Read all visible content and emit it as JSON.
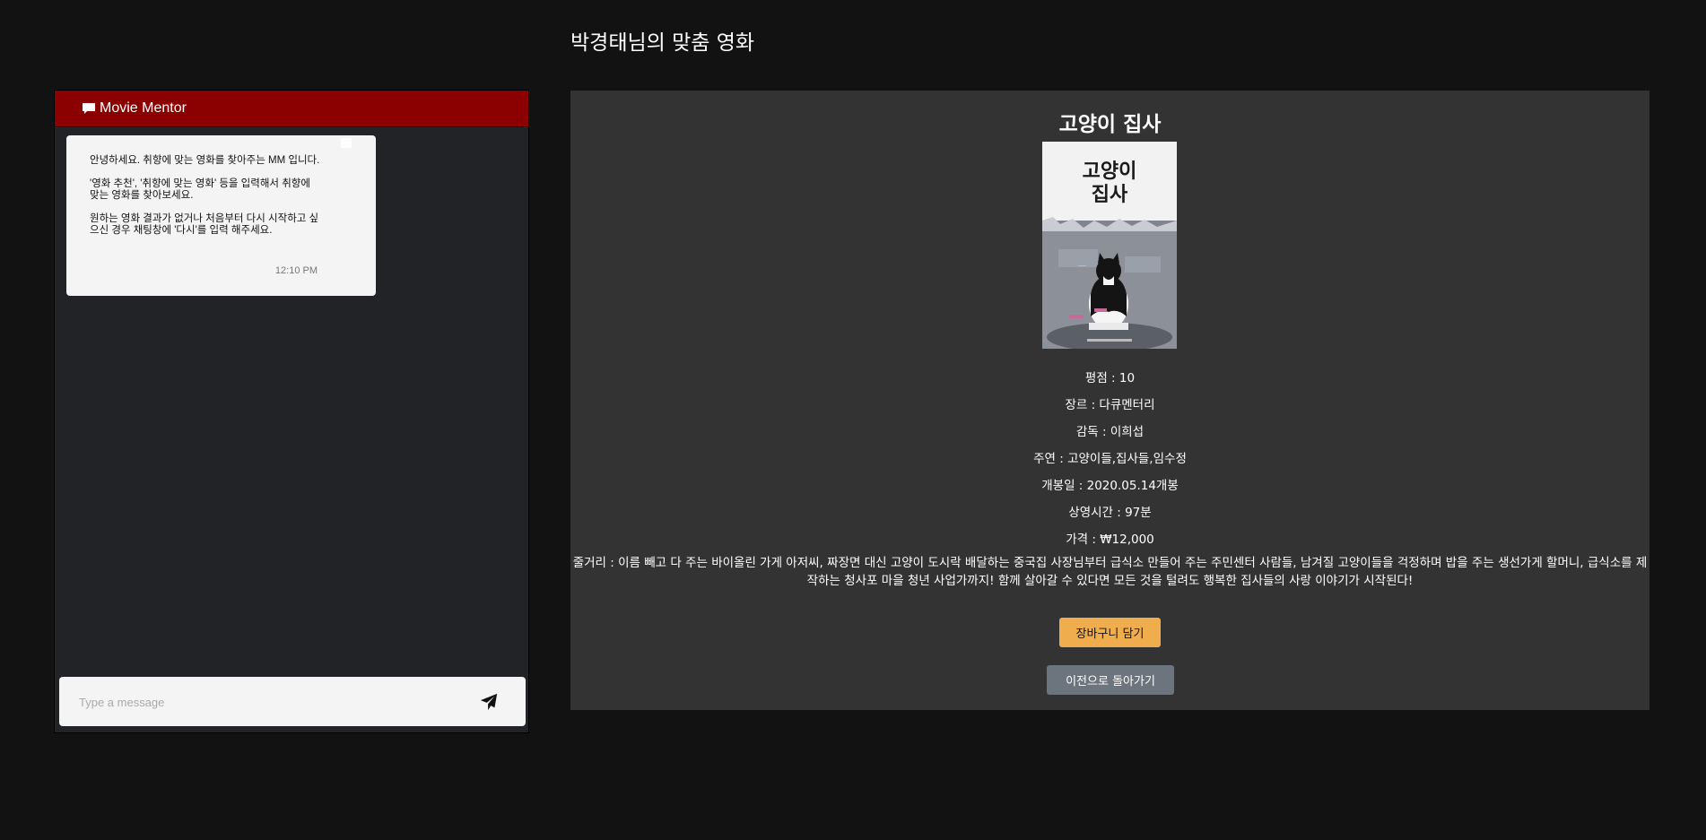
{
  "page": {
    "title": "박경태님의 맞춤 영화"
  },
  "chat": {
    "header_title": "Movie Mentor",
    "messages": [
      {
        "paragraphs": [
          "안녕하세요. 취향에 맞는 영화를 찾아주는 MM 입니다.",
          "'영화 추천', '취향에 맞는 영화' 등을 입력해서 취향에 맞는 영화를 찾아보세요.",
          "원하는 영화 결과가 없거나 처음부터 다시 시작하고 싶으신 경우 채팅창에 '다시'를 입력 해주세요."
        ],
        "time": "12:10 PM"
      }
    ],
    "input_placeholder": "Type a message",
    "input_value": ""
  },
  "movie": {
    "title": "고양이 집사",
    "poster_text": "고양이\n집사",
    "rating": "평점 : 10",
    "genre": "장르 : 다큐멘터리",
    "director": "감독 : 이희섭",
    "cast": "주연 : 고양이들,집사들,임수정",
    "release": "개봉일 : 2020.05.14개봉",
    "runtime": "상영시간 : 97분",
    "price": "가격 : ₩12,000",
    "plot": "줄거리 : 이름 빼고 다 주는 바이올린 가게 아저씨, 짜장면 대신 고양이 도시락 배달하는 중국집 사장님부터 급식소 만들어 주는 주민센터 사람들, 남겨질 고양이들을 걱정하며 밥을 주는 생선가게 할머니, 급식소를 제작하는 청사포 마을 청년 사업가까지! 함께 살아갈 수 있다면 모든 것을 털려도 행복한 집사들의 사랑 이야기가 시작된다!",
    "cart_button": "장바구니 담기",
    "back_button": "이전으로 돌아가기"
  },
  "colors": {
    "background": "#121212",
    "chat_header": "#8b0000",
    "chat_body": "#222326",
    "panel": "#333333",
    "cart_button": "#f0ad4e",
    "back_button": "#6c757d"
  },
  "icons": {
    "chat": "comment-icon",
    "send": "paper-plane-icon"
  }
}
